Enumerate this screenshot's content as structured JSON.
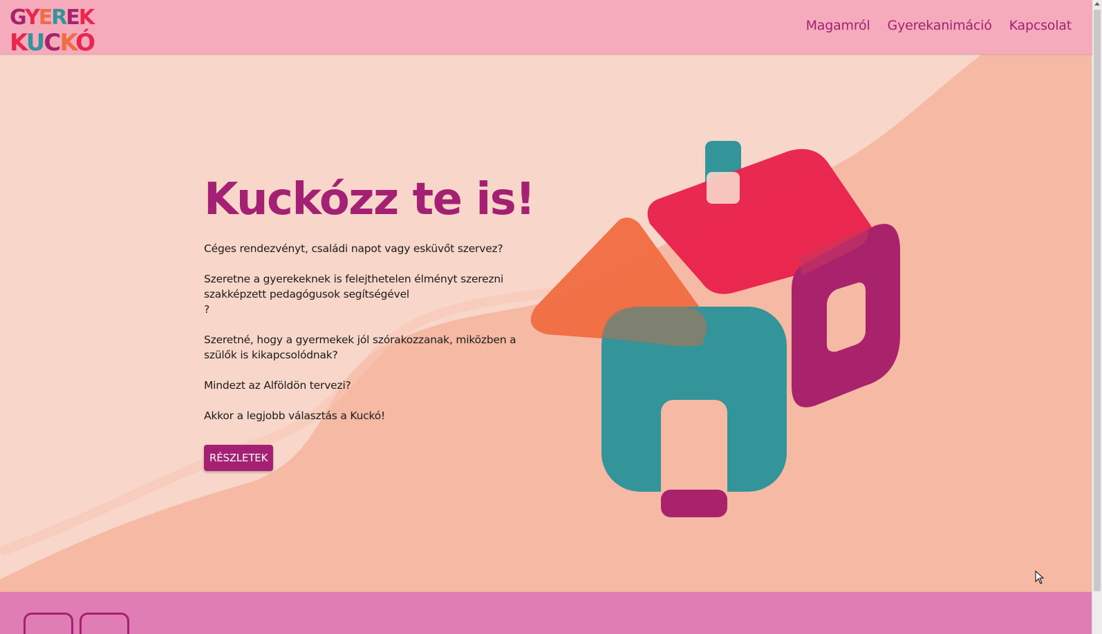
{
  "brand": {
    "logo_line1": "GYEREK",
    "logo_line2": "KUCKÓ"
  },
  "nav": {
    "items": [
      {
        "label": "Magamról"
      },
      {
        "label": "Gyerekanimáció"
      },
      {
        "label": "Kapcsolat"
      }
    ]
  },
  "hero": {
    "title": "Kuckózz te is!",
    "paragraphs": [
      "Céges rendezvényt, családi napot vagy esküvőt szervez?",
      "Szeretne a gyerekeknek is felejthetelen élményt szerezni szakképzett pedagógusok segítségével",
      "?",
      "Szeretné, hogy a gyermekek jól szórakozzanak, miközben a szülők is kikapcsolódnak?",
      "Mindezt az Alföldön tervezi?",
      "Akkor a legjobb választás a Kuckó!"
    ],
    "button_label": "RÉSZLETEK"
  },
  "colors": {
    "header_bg": "#f5abbc",
    "hero_bg": "#f9d6ca",
    "accent": "#a32073",
    "footer_bg": "#e07db5",
    "teal": "#339499",
    "red": "#ea254e",
    "orange": "#f06c41",
    "plum": "#a8226c"
  },
  "footer": {
    "icons": [
      "instagram-icon",
      "facebook-icon"
    ]
  }
}
